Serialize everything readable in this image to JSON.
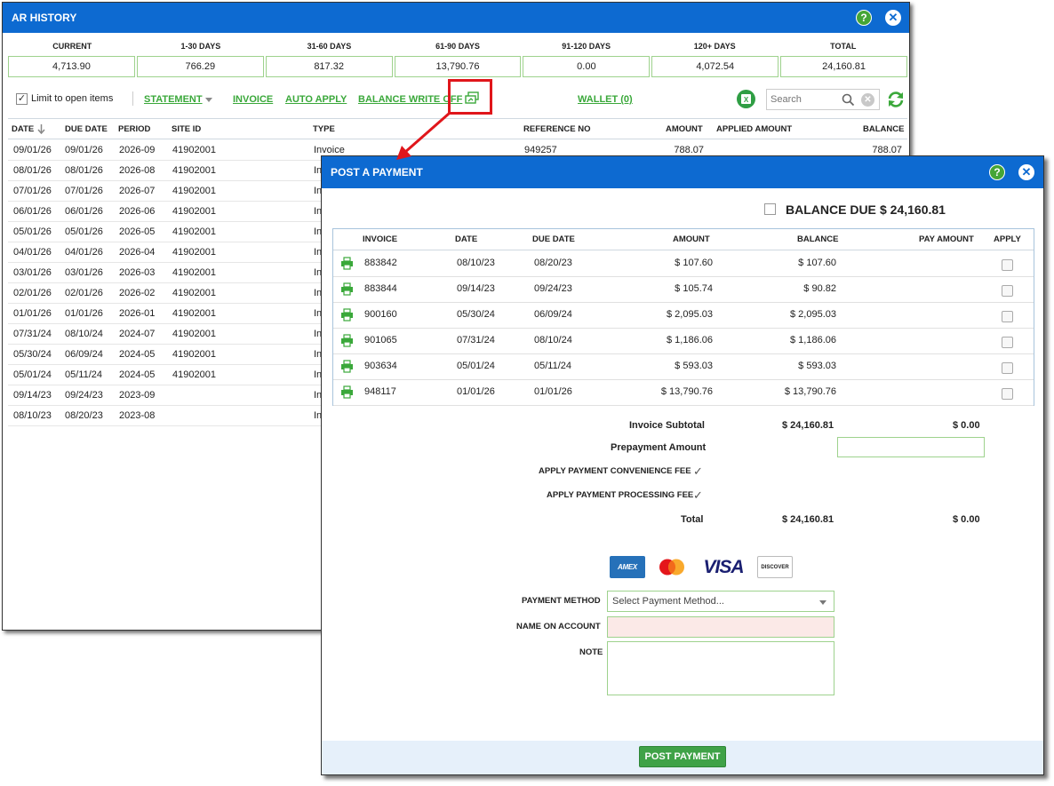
{
  "ar_history": {
    "title": "AR HISTORY",
    "help": "?",
    "close": "✕",
    "aging": {
      "headers": [
        "CURRENT",
        "1-30 DAYS",
        "31-60 DAYS",
        "61-90 DAYS",
        "91-120 DAYS",
        "120+ DAYS",
        "TOTAL"
      ],
      "values": [
        "4,713.90",
        "766.29",
        "817.32",
        "13,790.76",
        "0.00",
        "4,072.54",
        "24,160.81"
      ]
    },
    "toolbar": {
      "limit_label": "Limit to open items",
      "statement": "STATEMENT",
      "invoice": "INVOICE",
      "auto_apply": "AUTO APPLY",
      "balance_write_off": "BALANCE WRITE OFF",
      "wallet": "WALLET (0)",
      "search_placeholder": "Search"
    },
    "columns": [
      "DATE",
      "DUE DATE",
      "PERIOD",
      "SITE ID",
      "TYPE",
      "REFERENCE NO",
      "AMOUNT",
      "APPLIED AMOUNT",
      "BALANCE"
    ],
    "rows": [
      {
        "date": "09/01/26",
        "due": "09/01/26",
        "period": "2026-09",
        "site": "41902001",
        "type": "Invoice",
        "ref": "949257",
        "amount": "788.07",
        "balance": "788.07"
      },
      {
        "date": "08/01/26",
        "due": "08/01/26",
        "period": "2026-08",
        "site": "41902001",
        "type": "In"
      },
      {
        "date": "07/01/26",
        "due": "07/01/26",
        "period": "2026-07",
        "site": "41902001",
        "type": "In"
      },
      {
        "date": "06/01/26",
        "due": "06/01/26",
        "period": "2026-06",
        "site": "41902001",
        "type": "In"
      },
      {
        "date": "05/01/26",
        "due": "05/01/26",
        "period": "2026-05",
        "site": "41902001",
        "type": "In"
      },
      {
        "date": "04/01/26",
        "due": "04/01/26",
        "period": "2026-04",
        "site": "41902001",
        "type": "In"
      },
      {
        "date": "03/01/26",
        "due": "03/01/26",
        "period": "2026-03",
        "site": "41902001",
        "type": "In"
      },
      {
        "date": "02/01/26",
        "due": "02/01/26",
        "period": "2026-02",
        "site": "41902001",
        "type": "In"
      },
      {
        "date": "01/01/26",
        "due": "01/01/26",
        "period": "2026-01",
        "site": "41902001",
        "type": "In"
      },
      {
        "date": "07/31/24",
        "due": "08/10/24",
        "period": "2024-07",
        "site": "41902001",
        "type": "In"
      },
      {
        "date": "05/30/24",
        "due": "06/09/24",
        "period": "2024-05",
        "site": "41902001",
        "type": "In"
      },
      {
        "date": "05/01/24",
        "due": "05/11/24",
        "period": "2024-05",
        "site": "41902001",
        "type": "In"
      },
      {
        "date": "09/14/23",
        "due": "09/24/23",
        "period": "2023-09",
        "site": "",
        "type": "In"
      },
      {
        "date": "08/10/23",
        "due": "08/20/23",
        "period": "2023-08",
        "site": "",
        "type": "In"
      }
    ]
  },
  "post_payment": {
    "title": "POST A PAYMENT",
    "help": "?",
    "close": "✕",
    "balance_due_label": "BALANCE DUE",
    "balance_due_value": "$ 24,160.81",
    "columns": [
      "INVOICE",
      "DATE",
      "DUE DATE",
      "AMOUNT",
      "BALANCE",
      "PAY AMOUNT",
      "APPLY"
    ],
    "invoices": [
      {
        "invoice": "883842",
        "date": "08/10/23",
        "due": "08/20/23",
        "amount": "$ 107.60",
        "balance": "$ 107.60"
      },
      {
        "invoice": "883844",
        "date": "09/14/23",
        "due": "09/24/23",
        "amount": "$ 105.74",
        "balance": "$ 90.82"
      },
      {
        "invoice": "900160",
        "date": "05/30/24",
        "due": "06/09/24",
        "amount": "$ 2,095.03",
        "balance": "$ 2,095.03"
      },
      {
        "invoice": "901065",
        "date": "07/31/24",
        "due": "08/10/24",
        "amount": "$ 1,186.06",
        "balance": "$ 1,186.06"
      },
      {
        "invoice": "903634",
        "date": "05/01/24",
        "due": "05/11/24",
        "amount": "$ 593.03",
        "balance": "$ 593.03"
      },
      {
        "invoice": "948117",
        "date": "01/01/26",
        "due": "01/01/26",
        "amount": "$ 13,790.76",
        "balance": "$ 13,790.76"
      }
    ],
    "summary": {
      "invoice_subtotal_label": "Invoice Subtotal",
      "invoice_subtotal_value": "$ 24,160.81",
      "invoice_subtotal_pay": "$ 0.00",
      "prepayment_label": "Prepayment Amount",
      "convenience_fee_label": "APPLY PAYMENT CONVENIENCE FEE",
      "processing_fee_label": "APPLY PAYMENT PROCESSING FEE",
      "total_label": "Total",
      "total_value": "$ 24,160.81",
      "total_pay": "$ 0.00"
    },
    "cards": {
      "amex_text": "AMEX",
      "visa_text": "VISA",
      "discover_text": "DISCOVER"
    },
    "form": {
      "payment_method_label": "PAYMENT METHOD",
      "payment_method_value": "Select Payment Method...",
      "name_label": "NAME ON ACCOUNT",
      "note_label": "NOTE"
    },
    "post_button": "POST PAYMENT"
  },
  "colors": {
    "title_blue": "#0d6ad1",
    "link_green": "#3aa83a",
    "callout_red": "#e0161b"
  }
}
